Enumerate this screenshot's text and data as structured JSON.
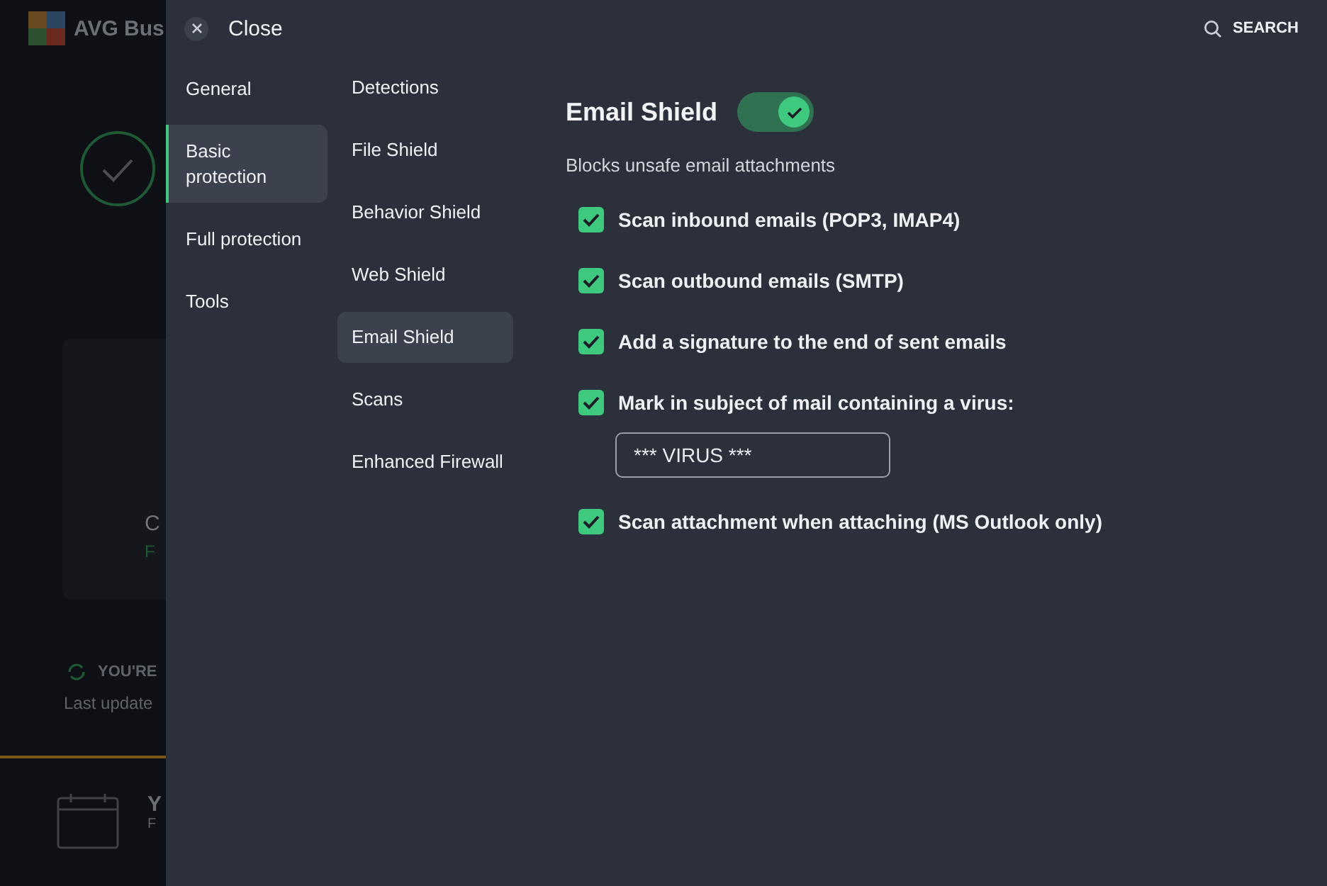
{
  "background_app": {
    "brand": "AVG Bus",
    "card_title": "C",
    "card_subtitle": "F",
    "update_status": "YOU'RE",
    "last_updated": "Last update",
    "footer_title": "Y",
    "footer_subtitle": "F"
  },
  "header": {
    "close_label": "Close",
    "search_label": "SEARCH"
  },
  "categories": [
    {
      "label": "General",
      "selected": false
    },
    {
      "label": "Basic protection",
      "selected": true
    },
    {
      "label": "Full protection",
      "selected": false
    },
    {
      "label": "Tools",
      "selected": false
    }
  ],
  "sections": [
    {
      "label": "Detections",
      "selected": false
    },
    {
      "label": "File Shield",
      "selected": false
    },
    {
      "label": "Behavior Shield",
      "selected": false
    },
    {
      "label": "Web Shield",
      "selected": false
    },
    {
      "label": "Email Shield",
      "selected": true
    },
    {
      "label": "Scans",
      "selected": false
    },
    {
      "label": "Enhanced Firewall",
      "selected": false
    }
  ],
  "content": {
    "title": "Email Shield",
    "enabled": true,
    "description": "Blocks unsafe email attachments",
    "options": [
      {
        "label": "Scan inbound emails (POP3, IMAP4)",
        "checked": true
      },
      {
        "label": "Scan outbound emails (SMTP)",
        "checked": true
      },
      {
        "label": "Add a signature to the end of sent emails",
        "checked": true
      },
      {
        "label": "Mark in subject of mail containing a virus:",
        "checked": true,
        "field": {
          "value": "*** VIRUS ***"
        }
      },
      {
        "label": "Scan attachment when attaching (MS Outlook only)",
        "checked": true
      }
    ]
  }
}
